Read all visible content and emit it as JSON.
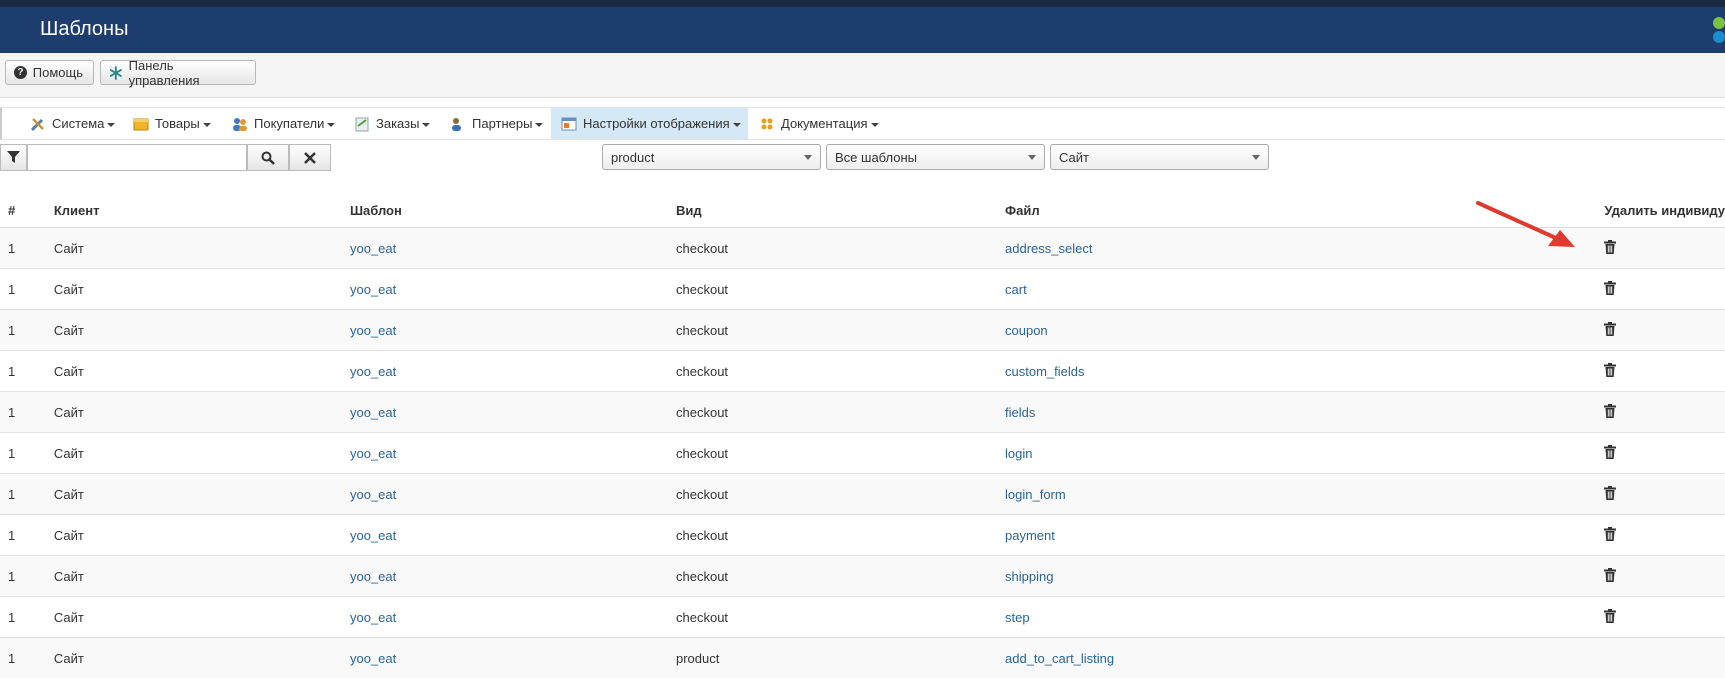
{
  "header": {
    "title": "Шаблоны"
  },
  "toolbar": {
    "help_label": "Помощь",
    "panel_label": "Панель управления"
  },
  "menu": [
    {
      "label": "Система",
      "icon": "tools-icon"
    },
    {
      "label": "Товары",
      "icon": "box-icon"
    },
    {
      "label": "Покупатели",
      "icon": "users-icon"
    },
    {
      "label": "Заказы",
      "icon": "orders-icon"
    },
    {
      "label": "Партнеры",
      "icon": "partners-icon"
    },
    {
      "label": "Настройки отображения",
      "icon": "display-settings-icon",
      "active": true
    },
    {
      "label": "Документация",
      "icon": "documentation-icon"
    }
  ],
  "filters": {
    "search_value": "",
    "type_select": "product",
    "template_select": "Все шаблоны",
    "client_select": "Сайт"
  },
  "table": {
    "columns": [
      "#",
      "Клиент",
      "Шаблон",
      "Вид",
      "Файл",
      "Удалить индивиду"
    ],
    "rows": [
      [
        "1",
        "Сайт",
        "yoo_eat",
        "checkout",
        "address_select"
      ],
      [
        "1",
        "Сайт",
        "yoo_eat",
        "checkout",
        "cart"
      ],
      [
        "1",
        "Сайт",
        "yoo_eat",
        "checkout",
        "coupon"
      ],
      [
        "1",
        "Сайт",
        "yoo_eat",
        "checkout",
        "custom_fields"
      ],
      [
        "1",
        "Сайт",
        "yoo_eat",
        "checkout",
        "fields"
      ],
      [
        "1",
        "Сайт",
        "yoo_eat",
        "checkout",
        "login"
      ],
      [
        "1",
        "Сайт",
        "yoo_eat",
        "checkout",
        "login_form"
      ],
      [
        "1",
        "Сайт",
        "yoo_eat",
        "checkout",
        "payment"
      ],
      [
        "1",
        "Сайт",
        "yoo_eat",
        "checkout",
        "shipping"
      ],
      [
        "1",
        "Сайт",
        "yoo_eat",
        "checkout",
        "step"
      ],
      [
        "1",
        "Сайт",
        "yoo_eat",
        "product",
        "add_to_cart_listing"
      ]
    ]
  },
  "colors": {
    "header_bg": "#1c3d6e",
    "link": "#2a6496",
    "annotation_arrow": "#e03a2f"
  }
}
